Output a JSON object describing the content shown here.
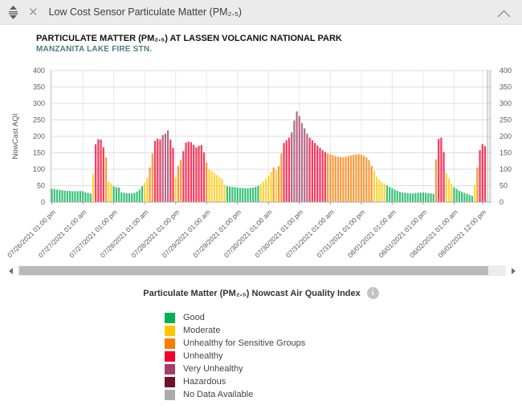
{
  "window": {
    "title": "Low Cost Sensor Particulate Matter (PM₂.₅)"
  },
  "chart": {
    "title": "PARTICULATE MATTER (PM₂.₅) AT LASSEN VOLCANIC NATIONAL PARK",
    "subtitle": "MANZANITA LAKE FIRE STN."
  },
  "chart_data": {
    "type": "bar",
    "title": "PARTICULATE MATTER (PM2.5) AT LASSEN VOLCANIC NATIONAL PARK",
    "subtitle": "MANZANITA LAKE FIRE STN.",
    "ylabel": "NowCast AQI",
    "ylim": [
      0,
      400
    ],
    "ytick_step": 50,
    "grid": true,
    "x_tick_labels": [
      "07/26/2021 01:00 pm",
      "07/27/2021 01:00 am",
      "07/27/2021 01:00 pm",
      "07/28/2021 01:00 am",
      "07/28/2021 01:00 pm",
      "07/29/2021 01:00 am",
      "07/29/2021 01:00 pm",
      "07/30/2021 01:00 am",
      "07/30/2021 01:00 pm",
      "07/31/2021 01:00 am",
      "07/31/2021 01:00 pm",
      "08/01/2021 01:00 am",
      "08/01/2021 01:00 pm",
      "08/02/2021 01:00 am",
      "08/02/2021 12:00 pm"
    ],
    "tick_indices": [
      0,
      12,
      24,
      36,
      48,
      60,
      72,
      84,
      96,
      108,
      120,
      132,
      144,
      156,
      167
    ],
    "values": [
      40,
      39,
      38,
      37,
      36,
      35,
      34,
      34,
      33,
      33,
      33,
      34,
      33,
      30,
      28,
      26,
      85,
      176,
      191,
      190,
      167,
      136,
      62,
      57,
      48,
      45,
      44,
      30,
      28,
      27,
      27,
      26,
      28,
      32,
      38,
      48,
      58,
      75,
      105,
      148,
      186,
      193,
      190,
      204,
      208,
      218,
      190,
      165,
      75,
      110,
      128,
      155,
      181,
      184,
      182,
      174,
      166,
      171,
      173,
      151,
      120,
      100,
      95,
      88,
      82,
      75,
      70,
      52,
      48,
      47,
      46,
      45,
      44,
      43,
      43,
      42,
      42,
      43,
      44,
      46,
      49,
      55,
      62,
      70,
      80,
      92,
      105,
      98,
      110,
      148,
      180,
      188,
      196,
      212,
      248,
      276,
      262,
      240,
      224,
      208,
      196,
      188,
      180,
      172,
      165,
      158,
      152,
      148,
      145,
      143,
      140,
      138,
      137,
      136,
      138,
      140,
      142,
      144,
      145,
      146,
      144,
      141,
      136,
      128,
      110,
      95,
      78,
      68,
      60,
      55,
      50,
      46,
      42,
      38,
      34,
      31,
      29,
      28,
      27,
      26,
      26,
      27,
      28,
      29,
      29,
      28,
      27,
      26,
      25,
      130,
      192,
      196,
      152,
      88,
      72,
      55,
      45,
      40,
      35,
      31,
      28,
      25,
      22,
      19,
      52,
      105,
      158,
      176,
      170,
      null,
      null
    ]
  },
  "legend": {
    "title": "Particulate Matter (PM₂.₅) Nowcast Air Quality Index",
    "info_icon": "i",
    "items": [
      {
        "label": "Good",
        "color": "#00b152",
        "max": 50
      },
      {
        "label": "Moderate",
        "color": "#ffc600",
        "max": 100
      },
      {
        "label": "Unhealthy for Sensitive Groups",
        "color": "#f87e00",
        "max": 150
      },
      {
        "label": "Unhealthy",
        "color": "#f3002e",
        "max": 200
      },
      {
        "label": "Very Unhealthy",
        "color": "#a23f66",
        "max": 300
      },
      {
        "label": "Hazardous",
        "color": "#6d1228",
        "max": 500
      },
      {
        "label": "No Data Available",
        "color": "#ababab",
        "max": null
      }
    ]
  }
}
